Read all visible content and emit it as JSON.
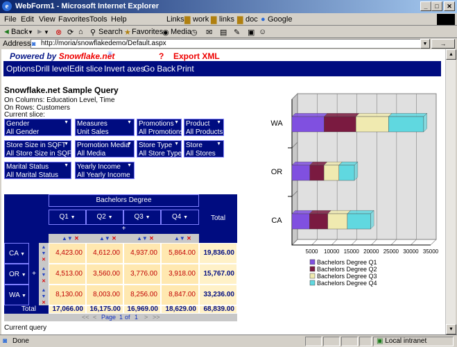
{
  "window": {
    "title": "WebForm1 - Microsoft Internet Explorer"
  },
  "menu": [
    "File",
    "Edit",
    "View",
    "Favorites",
    "Tools",
    "Help"
  ],
  "links": {
    "label": "Links",
    "items": [
      "work",
      "links",
      "doc",
      "Google"
    ]
  },
  "toolbar": {
    "back": "Back",
    "search": "Search",
    "favorites": "Favorites",
    "media": "Media"
  },
  "address": {
    "label": "Address",
    "url": "http://moria/snowflakedemo/Default.aspx"
  },
  "header": {
    "powered": "Powered by ",
    "brand": "Snowflake.net",
    "question": "?",
    "export": "Export XML"
  },
  "nav": [
    "Options",
    "Drill level",
    "Edit slice",
    "Invert axes",
    "Go Back",
    "Print"
  ],
  "query": {
    "title": "Snowflake.net Sample Query",
    "columns": "On Columns: Education Level, Time",
    "rows": "On Rows: Customers",
    "slice": "Current slice:"
  },
  "filters": [
    {
      "name": "Gender",
      "value": "All Gender"
    },
    {
      "name": "Measures",
      "value": "Unit Sales"
    },
    {
      "name": "Promotions",
      "value": "All Promotions"
    },
    {
      "name": "Product",
      "value": "All Products"
    },
    {
      "name": "Store Size in SQFT",
      "value": "All Store Size in SQFT"
    },
    {
      "name": "Promotion Media",
      "value": "All Media"
    },
    {
      "name": "Store Type",
      "value": "All Store Type"
    },
    {
      "name": "Store",
      "value": "All Stores"
    },
    {
      "name": "Marital Status",
      "value": "All Marital Status"
    },
    {
      "name": "Yearly Income",
      "value": "All Yearly Income"
    }
  ],
  "pivot": {
    "group": "Bachelors Degree",
    "total_label": "Total",
    "quarters": [
      "Q1",
      "Q2",
      "Q3",
      "Q4"
    ],
    "rows": [
      {
        "label": "CA",
        "values": [
          "4,423.00",
          "4,612.00",
          "4,937.00",
          "5,864.00"
        ],
        "total": "19,836.00"
      },
      {
        "label": "OR",
        "values": [
          "4,513.00",
          "3,560.00",
          "3,776.00",
          "3,918.00"
        ],
        "total": "15,767.00"
      },
      {
        "label": "WA",
        "values": [
          "8,130.00",
          "8,003.00",
          "8,256.00",
          "8,847.00"
        ],
        "total": "33,236.00"
      }
    ],
    "col_totals": [
      "17,066.00",
      "16,175.00",
      "16,969.00",
      "18,629.00"
    ],
    "grand_total": "68,839.00",
    "pager": {
      "first": "<<",
      "prev": "<",
      "page": "Page",
      "num": "1",
      "of": "of",
      "total": "1",
      "next": ">",
      "last": ">>"
    }
  },
  "footer": {
    "current_query": "Current query"
  },
  "status": {
    "done": "Done",
    "zone": "Local intranet"
  },
  "colors": {
    "navy": "#000c80",
    "q1": "#8050e0",
    "q2": "#7a1a40",
    "q3": "#f0eab0",
    "q4": "#60d8e0"
  },
  "chart_data": {
    "type": "bar",
    "orientation": "horizontal",
    "categories": [
      "WA",
      "OR",
      "CA"
    ],
    "series": [
      {
        "name": "Bachelors Degree Q1",
        "values": [
          8130,
          4513,
          4423
        ]
      },
      {
        "name": "Bachelors Degree Q2",
        "values": [
          8003,
          3560,
          4612
        ]
      },
      {
        "name": "Bachelors Degree Q3",
        "values": [
          8256,
          3776,
          4937
        ]
      },
      {
        "name": "Bachelors Degree Q4",
        "values": [
          8847,
          3918,
          5864
        ]
      }
    ],
    "stacked": true,
    "xticks": [
      "5000",
      "10000",
      "15000",
      "20000",
      "25000",
      "30000",
      "35000"
    ],
    "xlim": [
      0,
      35000
    ],
    "grid": true,
    "legend": "bottom"
  }
}
